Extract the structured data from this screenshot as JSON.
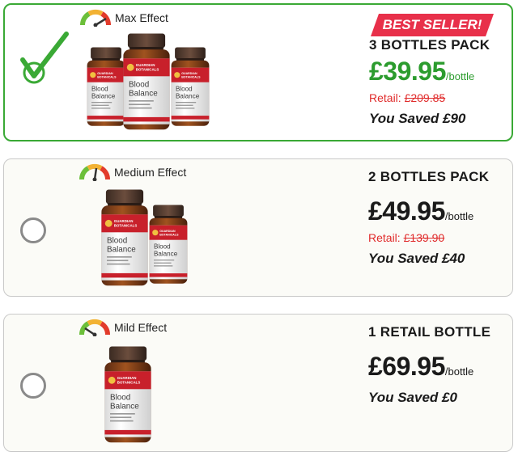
{
  "colors": {
    "accent_green": "#2c9c2e",
    "retail_red": "#e02b2b",
    "badge_red": "#e8304a",
    "selected_border": "#3aa935"
  },
  "offers": [
    {
      "selected": true,
      "effect_label": "Max Effect",
      "gauge_level": "max",
      "badge": "BEST SELLER!",
      "pack_title": "3 BOTTLES PACK",
      "price": "£39.95",
      "per_unit": "/bottle",
      "retail_label": "Retail:",
      "retail_price": "£209.85",
      "saved": "You Saved £90",
      "bottle_count": 3,
      "bottle_brand": "Blood Balance",
      "bottle_maker": "GUARDIAN BOTANICALS"
    },
    {
      "selected": false,
      "effect_label": "Medium Effect",
      "gauge_level": "medium",
      "pack_title": "2 BOTTLES PACK",
      "price": "£49.95",
      "per_unit": "/bottle",
      "retail_label": "Retail:",
      "retail_price": "£139.90",
      "saved": "You Saved £40",
      "bottle_count": 2,
      "bottle_brand": "Blood Balance",
      "bottle_maker": "GUARDIAN BOTANICALS"
    },
    {
      "selected": false,
      "effect_label": "Mild Effect",
      "gauge_level": "mild",
      "pack_title": "1 RETAIL BOTTLE",
      "price": "£69.95",
      "per_unit": "/bottle",
      "saved": "You Saved £0",
      "bottle_count": 1,
      "bottle_brand": "Blood Balance",
      "bottle_maker": "GUARDIAN BOTANICALS"
    }
  ]
}
